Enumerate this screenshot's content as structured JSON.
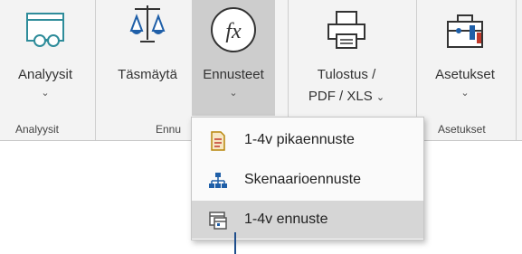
{
  "ribbon": {
    "buttons": [
      {
        "label": "Analyysit",
        "chevron": "⌄",
        "icon": "glasses-window-icon"
      },
      {
        "label": "Täsmäytä",
        "icon": "scales-icon"
      },
      {
        "label": "Ennusteet",
        "chevron": "⌄",
        "icon": "fx-function-icon"
      },
      {
        "label_line1": "Tulostus /",
        "label_line2": "PDF / XLS",
        "chevron": "⌄",
        "icon": "printer-icon"
      },
      {
        "label": "Asetukset",
        "chevron": "⌄",
        "icon": "toolbox-icon"
      }
    ],
    "groups": [
      {
        "label": "Analyysit"
      },
      {
        "label": "Ennu"
      },
      {
        "label": "Asetukset"
      }
    ]
  },
  "menu": {
    "items": [
      {
        "label": "1-4v pikaennuste",
        "icon": "document-icon"
      },
      {
        "label": "Skenaarioennuste",
        "icon": "hierarchy-icon"
      },
      {
        "label": "1-4v ennuste",
        "icon": "calendar-window-icon",
        "selected": true
      }
    ]
  },
  "colors": {
    "ribbon_bg": "#f3f3f3",
    "active_button_bg": "#cdcdcd",
    "selected_item_bg": "#d6d6d6",
    "icon_teal": "#2e8c9a",
    "icon_blue": "#1f5fa8",
    "icon_red": "#c0392b"
  }
}
